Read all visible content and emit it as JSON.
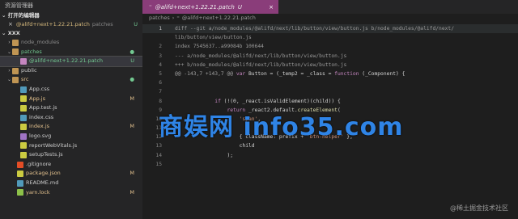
{
  "sidebar": {
    "title": "资源管理器",
    "open_editors_label": "打开的编辑器",
    "open_editors": [
      {
        "name": "@alifd+next+1.22.21.patch",
        "dir": "patches",
        "badge": "U"
      }
    ],
    "root_label": "XXX",
    "tree": [
      {
        "label": "node_modules",
        "chevron": "›",
        "type": "folder",
        "color": "dim",
        "badge": ""
      },
      {
        "label": "patches",
        "chevron": "⌄",
        "type": "folder",
        "color": "green",
        "badge": "●"
      },
      {
        "label": "@alifd+next+1.22.21.patch",
        "chevron": "",
        "type": "file-patch",
        "color": "green",
        "badge": "U"
      },
      {
        "label": "public",
        "chevron": "›",
        "type": "folder",
        "color": "normal",
        "badge": ""
      },
      {
        "label": "src",
        "chevron": "⌄",
        "type": "folder",
        "color": "yellow",
        "badge": "●"
      },
      {
        "label": "App.css",
        "chevron": "",
        "type": "file-css",
        "color": "normal",
        "badge": ""
      },
      {
        "label": "App.js",
        "chevron": "",
        "type": "file-js",
        "color": "yellow",
        "badge": "M"
      },
      {
        "label": "App.test.js",
        "chevron": "",
        "type": "file-js",
        "color": "normal",
        "badge": ""
      },
      {
        "label": "index.css",
        "chevron": "",
        "type": "file-css",
        "color": "normal",
        "badge": ""
      },
      {
        "label": "index.js",
        "chevron": "",
        "type": "file-js",
        "color": "yellow",
        "badge": "M"
      },
      {
        "label": "logo.svg",
        "chevron": "",
        "type": "file-svg",
        "color": "normal",
        "badge": ""
      },
      {
        "label": "reportWebVitals.js",
        "chevron": "",
        "type": "file-js",
        "color": "normal",
        "badge": ""
      },
      {
        "label": "setupTests.js",
        "chevron": "",
        "type": "file-js",
        "color": "normal",
        "badge": ""
      },
      {
        "label": ".gitignore",
        "chevron": "",
        "type": "file-git",
        "color": "normal",
        "badge": ""
      },
      {
        "label": "package.json",
        "chevron": "",
        "type": "file-json",
        "color": "yellow",
        "badge": "M"
      },
      {
        "label": "README.md",
        "chevron": "",
        "type": "file-md",
        "color": "normal",
        "badge": ""
      },
      {
        "label": "yarn.lock",
        "chevron": "",
        "type": "file-lock",
        "color": "yellow",
        "badge": "M"
      }
    ]
  },
  "editor": {
    "tab_label": "@alifd+next+1.22.21.patch",
    "tab_badge": "U",
    "breadcrumb": [
      "patches",
      "@alifd+next+1.22.21.patch"
    ],
    "lines": [
      {
        "num": "1",
        "parts": [
          {
            "c": "k-del",
            "t": "diff --git a/node_modules/@alifd/next/lib/button/view/button.js b/node_modules/@alifd/next/"
          }
        ]
      },
      {
        "num": "",
        "parts": [
          {
            "c": "k-del",
            "t": "lib/button/view/button.js"
          }
        ]
      },
      {
        "num": "2",
        "parts": [
          {
            "c": "k-del",
            "t": "index 7545637..a99084b 100644"
          }
        ]
      },
      {
        "num": "3",
        "parts": [
          {
            "c": "k-del",
            "t": "--- a/node_modules/@alifd/next/lib/button/view/button.js"
          }
        ]
      },
      {
        "num": "4",
        "parts": [
          {
            "c": "k-del",
            "t": "+++ b/node_modules/@alifd/next/lib/button/view/button.js"
          }
        ]
      },
      {
        "num": "5",
        "parts": [
          {
            "c": "k-hunk",
            "t": "@@ -143,7 +143,7 @@ "
          },
          {
            "c": "k-kw",
            "t": "var "
          },
          {
            "c": "k-plain",
            "t": "Button = (_temp2 = _class = "
          },
          {
            "c": "k-kw",
            "t": "function "
          },
          {
            "c": "k-plain",
            "t": "(_Component) {"
          }
        ]
      },
      {
        "num": "6",
        "parts": []
      },
      {
        "num": "7",
        "parts": []
      },
      {
        "num": "8",
        "parts": [
          {
            "c": "k-plain",
            "t": "             "
          },
          {
            "c": "k-kw",
            "t": "if "
          },
          {
            "c": "k-plain",
            "t": "(!(0, _react.isValidElement)(child)) {"
          }
        ]
      },
      {
        "num": "9",
        "parts": [
          {
            "c": "k-plain",
            "t": "                 "
          },
          {
            "c": "k-kw",
            "t": "return "
          },
          {
            "c": "k-plain",
            "t": "_react2.default."
          },
          {
            "c": "k-fn",
            "t": "createElement"
          },
          {
            "c": "k-plain",
            "t": "("
          }
        ]
      },
      {
        "num": "10",
        "parts": [
          {
            "c": "k-plain",
            "t": "                     "
          },
          {
            "c": "k-str",
            "t": "'span'"
          },
          {
            "c": "k-plain",
            "t": ","
          }
        ]
      },
      {
        "num": "11",
        "parts": []
      },
      {
        "num": "12",
        "parts": [
          {
            "c": "k-plain",
            "t": "                     { className: prefix + "
          },
          {
            "c": "k-str",
            "t": "'btn-helper'"
          },
          {
            "c": "k-plain",
            "t": " },"
          }
        ]
      },
      {
        "num": "13",
        "parts": [
          {
            "c": "k-plain",
            "t": "                     child"
          }
        ]
      },
      {
        "num": "14",
        "parts": [
          {
            "c": "k-plain",
            "t": "                 );"
          }
        ]
      },
      {
        "num": "15",
        "parts": []
      }
    ]
  },
  "overlay": {
    "watermark": "商娱网 info35.com",
    "credit": "@稀土掘金技术社区"
  },
  "colors": {
    "tab_bg": "#8a3d7a",
    "git_untracked": "#73c991",
    "git_modified": "#e2c08d",
    "watermark": "#2f84e6"
  }
}
